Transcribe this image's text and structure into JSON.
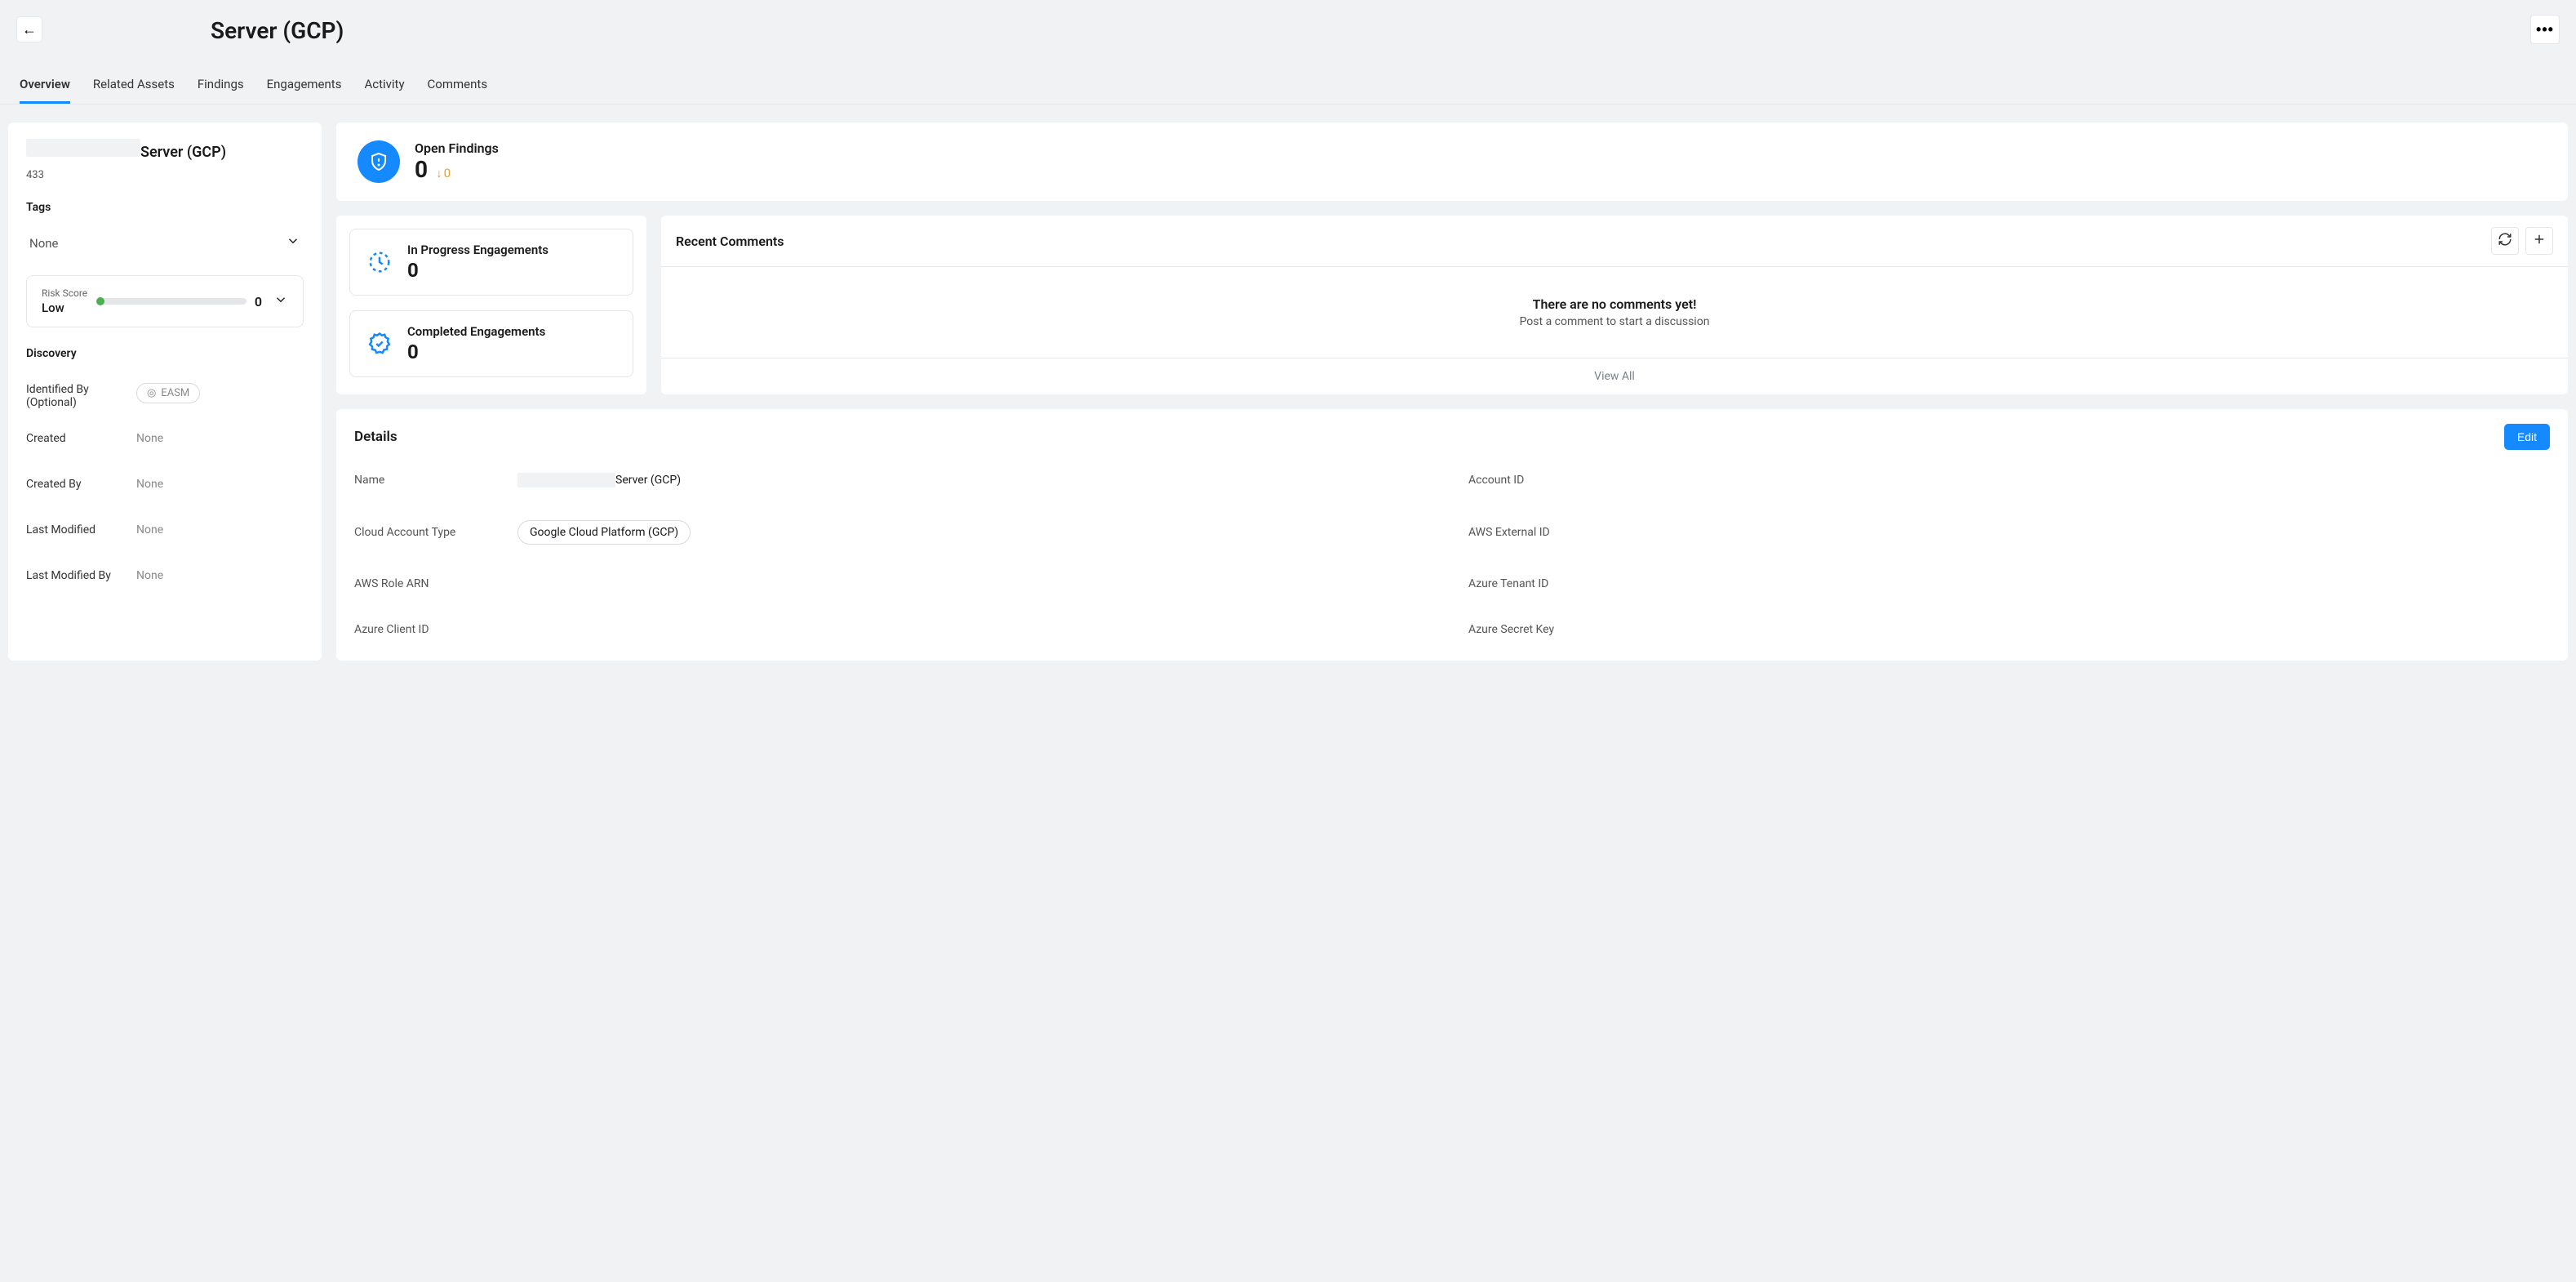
{
  "header": {
    "title_suffix": "Server (GCP)"
  },
  "tabs": [
    "Overview",
    "Related Assets",
    "Findings",
    "Engagements",
    "Activity",
    "Comments"
  ],
  "active_tab": "Overview",
  "sidebar": {
    "title_suffix": "Server (GCP)",
    "id": "433",
    "tags_label": "Tags",
    "tags_value": "None",
    "risk": {
      "label": "Risk Score",
      "level": "Low",
      "value": "0"
    },
    "discovery_label": "Discovery",
    "identified_by_label": "Identified By (Optional)",
    "identified_by_value": "EASM",
    "rows": [
      {
        "k": "Created",
        "v": "None"
      },
      {
        "k": "Created By",
        "v": "None"
      },
      {
        "k": "Last Modified",
        "v": "None"
      },
      {
        "k": "Last Modified By",
        "v": "None"
      }
    ]
  },
  "open_findings": {
    "title": "Open Findings",
    "value": "0",
    "delta": "0"
  },
  "engagements": {
    "in_progress": {
      "title": "In Progress Engagements",
      "value": "0"
    },
    "completed": {
      "title": "Completed Engagements",
      "value": "0"
    }
  },
  "comments": {
    "title": "Recent Comments",
    "empty_title": "There are no comments yet!",
    "empty_sub": "Post a comment to start a discussion",
    "view_all": "View All"
  },
  "details": {
    "title": "Details",
    "edit": "Edit",
    "fields": {
      "name_label": "Name",
      "name_suffix": " Server (GCP)",
      "account_id_label": "Account ID",
      "cloud_type_label": "Cloud Account Type",
      "cloud_type_value": "Google Cloud Platform (GCP)",
      "aws_external_label": "AWS External ID",
      "aws_role_label": "AWS Role ARN",
      "azure_tenant_label": "Azure Tenant ID",
      "azure_client_label": "Azure Client ID",
      "azure_secret_label": "Azure Secret Key"
    }
  }
}
